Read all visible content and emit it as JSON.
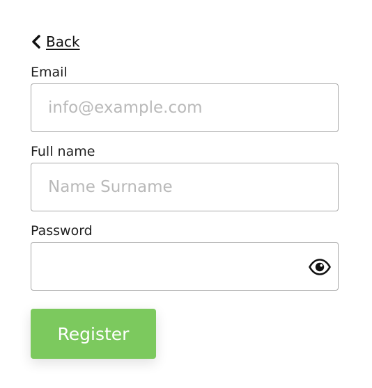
{
  "nav": {
    "back_label": "Back"
  },
  "form": {
    "email": {
      "label": "Email",
      "value": "",
      "placeholder": "info@example.com"
    },
    "full_name": {
      "label": "Full name",
      "value": "",
      "placeholder": "Name Surname"
    },
    "password": {
      "label": "Password",
      "value": "",
      "placeholder": ""
    },
    "submit_label": "Register"
  },
  "colors": {
    "accent": "#7cc95e",
    "border": "#a8a8a8",
    "placeholder": "#b9b9b9"
  },
  "icons": {
    "back": "chevron-left-icon",
    "toggle_password": "eye-icon"
  }
}
